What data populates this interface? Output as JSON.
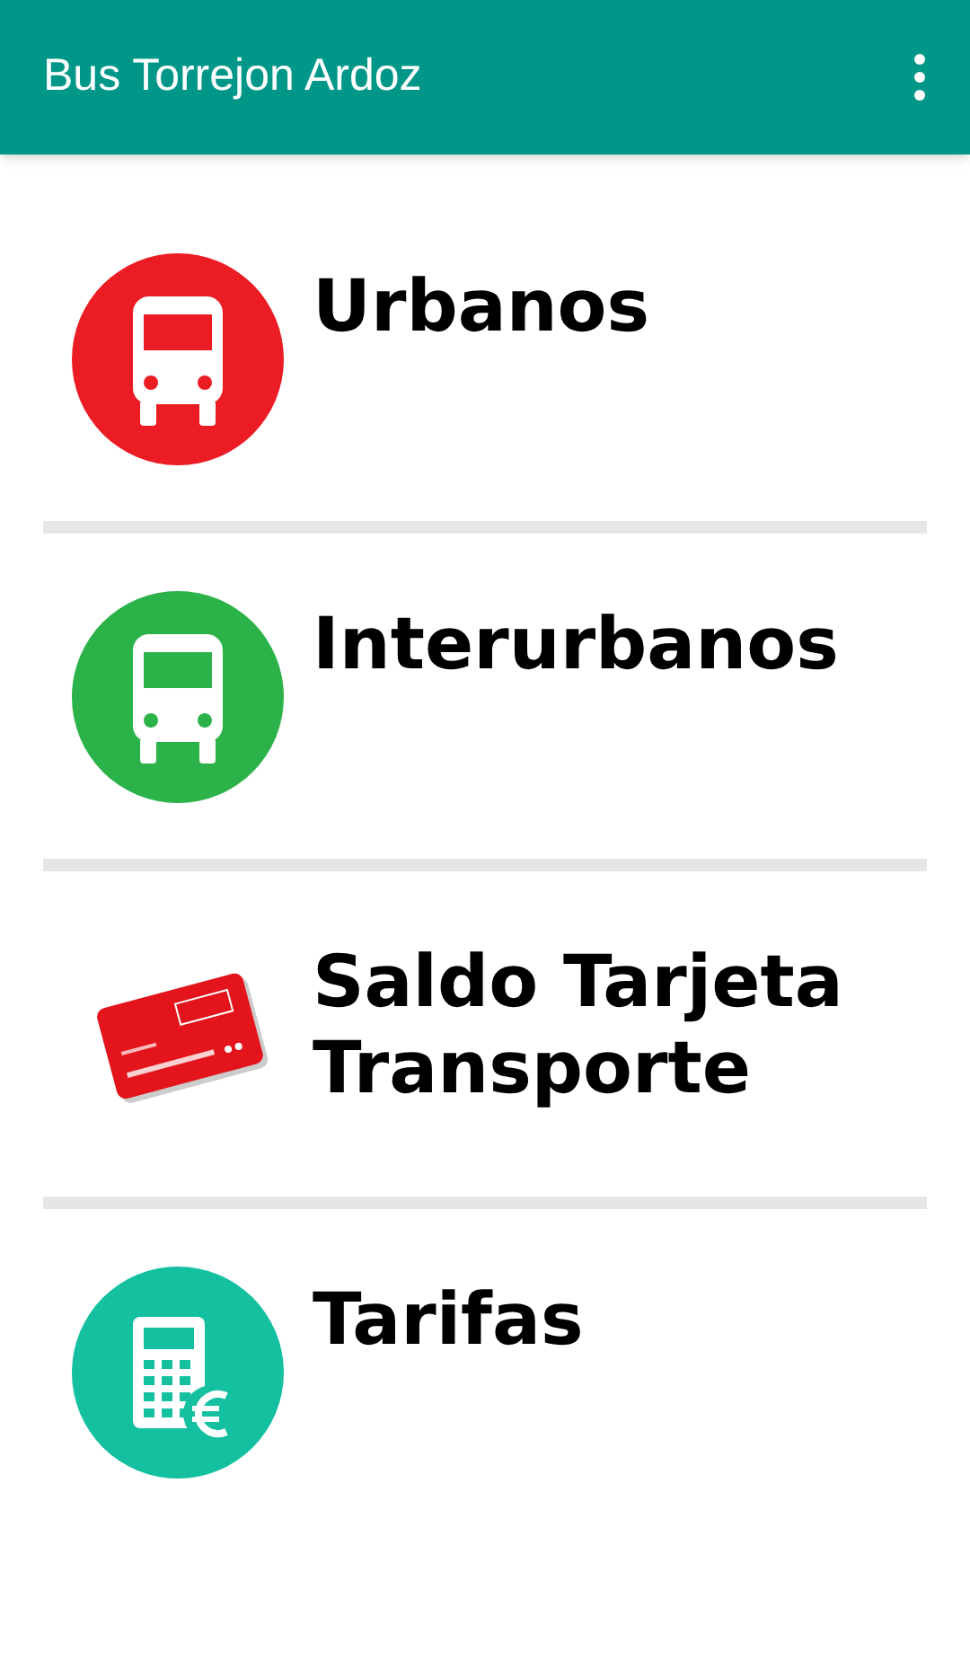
{
  "app_bar": {
    "title": "Bus Torrejon Ardoz"
  },
  "menu_items": [
    {
      "kind": "bus",
      "label": "Urbanos",
      "color": "#ec1c24"
    },
    {
      "kind": "bus",
      "label": "Interurbanos",
      "color": "#2bb34a"
    },
    {
      "kind": "card",
      "label": "Saldo Tarjeta Transporte"
    },
    {
      "kind": "calculator",
      "label": "Tarifas",
      "color": "#14c0a0"
    }
  ]
}
